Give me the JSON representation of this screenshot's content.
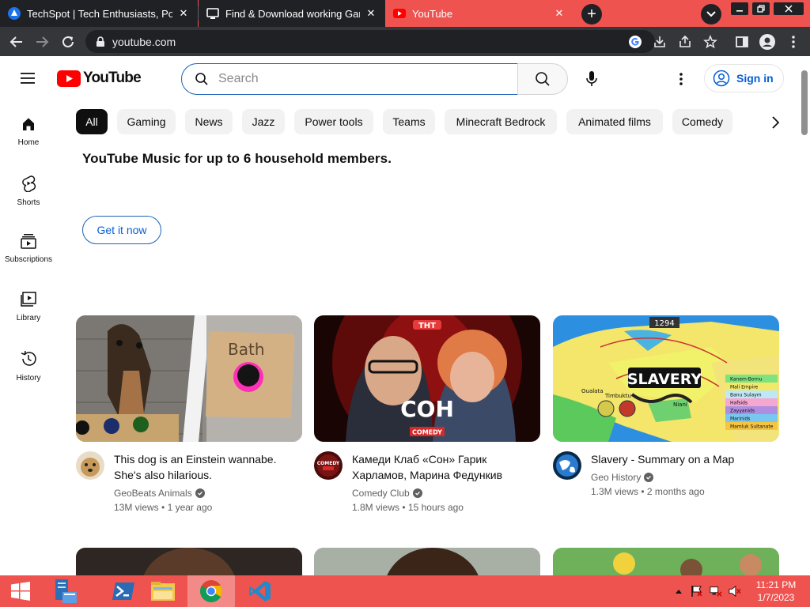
{
  "browser": {
    "tabs": [
      {
        "title": "TechSpot | Tech Enthusiasts, Power Users",
        "favicon": "techspot-icon",
        "active": false
      },
      {
        "title": "Find & Download working Games",
        "favicon": "monitor-icon",
        "active": false
      },
      {
        "title": "YouTube",
        "favicon": "youtube-icon",
        "active": true
      }
    ],
    "new_tab_label": "+",
    "url": "youtube.com",
    "colors": {
      "chrome_dark": "#202124",
      "toolbar": "#35363a",
      "theme": "#ef5350"
    }
  },
  "youtube": {
    "logo_text": "YouTube",
    "search": {
      "placeholder": "Search"
    },
    "signin_label": "Sign in",
    "sidebar": [
      {
        "label": "Home",
        "icon": "home-icon"
      },
      {
        "label": "Shorts",
        "icon": "shorts-icon"
      },
      {
        "label": "Subscriptions",
        "icon": "subscriptions-icon"
      },
      {
        "label": "Library",
        "icon": "library-icon"
      },
      {
        "label": "History",
        "icon": "history-icon"
      }
    ],
    "chips": [
      "All",
      "Gaming",
      "News",
      "Jazz",
      "Power tools",
      "Teams",
      "Minecraft Bedrock",
      "Animated films",
      "Comedy"
    ],
    "promo": {
      "title": "YouTube Music for up to 6 household members.",
      "button": "Get it now"
    },
    "videos": [
      {
        "title": "This dog is an Einstein wannabe. She's also hilarious.",
        "channel": "GeoBeats Animals",
        "views": "13M views",
        "age": "1 year ago",
        "thumb_text": "Bath"
      },
      {
        "title": "Камеди Клаб «Сон» Гарик Харламов, Марина Федункив",
        "channel": "Comedy Club",
        "views": "1.8M views",
        "age": "15 hours ago",
        "thumb_text": "СОН",
        "thumb_badge": "COMEDY",
        "thumb_logo": "ТНТ"
      },
      {
        "title": "Slavery - Summary on a Map",
        "channel": "Geo History",
        "views": "1.3M views",
        "age": "2 months ago",
        "thumb_text": "SLAVERY",
        "thumb_year": "1294",
        "thumb_legend": [
          "Kanem-Bornu",
          "Mali Empire",
          "Banu Sulaym",
          "Hafsids",
          "Zayyanids",
          "Marinids",
          "Mamluk Sultanate"
        ],
        "thumb_places": [
          "Oualata",
          "Timbuktu",
          "Niani"
        ]
      }
    ],
    "meta_separator": "•"
  },
  "taskbar": {
    "time": "11:21 PM",
    "date": "1/7/2023",
    "apps": [
      "start-icon",
      "file-server-icon",
      "powershell-icon",
      "file-explorer-icon",
      "chrome-icon",
      "vscode-icon"
    ]
  }
}
